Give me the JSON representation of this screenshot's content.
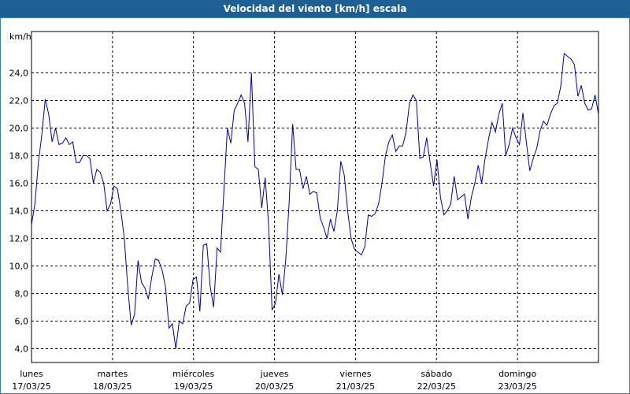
{
  "title": "Velocidad del viento [km/h] escala",
  "chart_data": {
    "type": "line",
    "title": "Velocidad del viento [km/h] escala",
    "ylabel": "km/h",
    "ylim": [
      3.0,
      27.0
    ],
    "y_ticks": [
      "4,0",
      "6,0",
      "8,0",
      "10,0",
      "12,0",
      "14,0",
      "16,0",
      "18,0",
      "20,0",
      "22,0",
      "24,0"
    ],
    "y_tick_values": [
      4,
      6,
      8,
      10,
      12,
      14,
      16,
      18,
      20,
      22,
      24
    ],
    "x_range_days": [
      0,
      7
    ],
    "x_ticks": [
      {
        "day": "lunes",
        "date": "17/03/25"
      },
      {
        "day": "martes",
        "date": "18/03/25"
      },
      {
        "day": "miércoles",
        "date": "19/03/25"
      },
      {
        "day": "jueves",
        "date": "20/03/25"
      },
      {
        "day": "viernes",
        "date": "21/03/25"
      },
      {
        "day": "sábado",
        "date": "22/03/25"
      },
      {
        "day": "domingo",
        "date": "23/03/25"
      }
    ],
    "grid": true,
    "line_color": "#0000aa",
    "series": [
      {
        "values": [
          13.0,
          14.5,
          17.5,
          19.5,
          22.1,
          21.0,
          19.0,
          20.0,
          18.8,
          18.9,
          19.3,
          18.8,
          19.0,
          17.5,
          17.5,
          18.0,
          18.0,
          17.8,
          16.0,
          17.0,
          16.8,
          16.0,
          14.0,
          14.5,
          15.8,
          15.6,
          14.0,
          12.0,
          8.5,
          5.7,
          6.5,
          10.4,
          8.8,
          8.4,
          7.6,
          9.2,
          10.5,
          10.4,
          9.7,
          8.5,
          5.5,
          5.8,
          4.0,
          6.0,
          5.8,
          7.1,
          7.3,
          9.0,
          9.2,
          6.7,
          11.5,
          11.6,
          8.5,
          7.0,
          11.3,
          11.0,
          15.5,
          20.0,
          18.9,
          21.3,
          21.8,
          22.4,
          21.8,
          19.0,
          24.0,
          17.2,
          17.0,
          14.2,
          16.4,
          13.0,
          6.8,
          7.3,
          9.4,
          7.9,
          10.5,
          14.7,
          20.3,
          17.0,
          17.0,
          15.6,
          16.5,
          15.2,
          15.4,
          15.3,
          13.5,
          12.8,
          12.0,
          13.4,
          12.5,
          14.0,
          17.6,
          16.6,
          14.0,
          12.0,
          11.2,
          11.0,
          10.8,
          11.4,
          13.7,
          13.6,
          13.8,
          14.5,
          16.0,
          18.0,
          19.0,
          19.5,
          18.3,
          18.7,
          18.7,
          19.7,
          21.8,
          22.4,
          22.0,
          17.8,
          17.9,
          19.3,
          17.5,
          15.8,
          17.7,
          15.0,
          13.7,
          14.0,
          14.5,
          16.5,
          14.8,
          15.0,
          15.2,
          13.4,
          15.0,
          16.0,
          17.3,
          16.0,
          17.8,
          19.2,
          20.4,
          19.7,
          21.0,
          21.8,
          18.0,
          18.8,
          20.0,
          19.3,
          18.8,
          21.1,
          19.0,
          16.9,
          17.8,
          18.5,
          19.8,
          20.5,
          20.2,
          21.0,
          21.6,
          21.8,
          23.0,
          25.4,
          25.2,
          25.0,
          24.6,
          22.3,
          23.1,
          21.8,
          21.3,
          21.4,
          22.4,
          21.0
        ]
      }
    ]
  }
}
